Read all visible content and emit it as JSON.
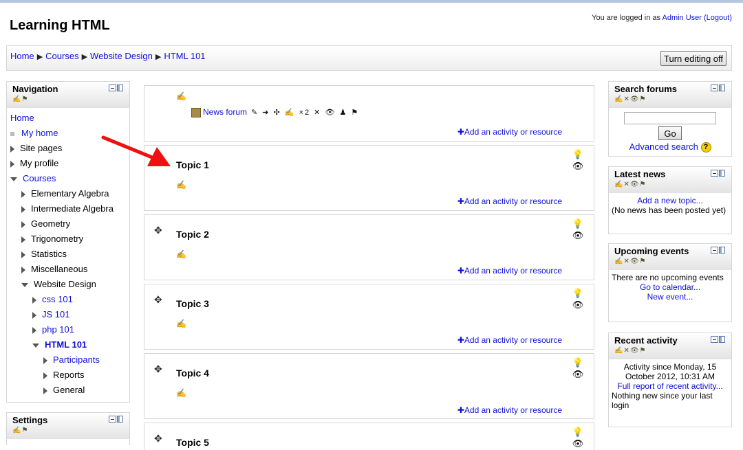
{
  "site": {
    "title": "Learning HTML"
  },
  "login": {
    "prefix": "You are logged in as",
    "user": "Admin User",
    "logout": "(Logout)"
  },
  "breadcrumb": {
    "items": [
      "Home",
      "Courses",
      "Website Design",
      "HTML 101"
    ],
    "separator": "▶"
  },
  "edit_button": "Turn editing off",
  "navigation": {
    "title": "Navigation",
    "items": [
      {
        "label": "Home",
        "level": 0,
        "marker": "none",
        "link": true
      },
      {
        "label": "My home",
        "level": 0,
        "marker": "bullet",
        "link": true
      },
      {
        "label": "Site pages",
        "level": 0,
        "marker": "collapsed",
        "link": false
      },
      {
        "label": "My profile",
        "level": 0,
        "marker": "collapsed",
        "link": false
      },
      {
        "label": "Courses",
        "level": 0,
        "marker": "expanded",
        "link": true
      },
      {
        "label": "Elementary Algebra",
        "level": 1,
        "marker": "collapsed",
        "link": false
      },
      {
        "label": "Intermediate Algebra",
        "level": 1,
        "marker": "collapsed",
        "link": false
      },
      {
        "label": "Geometry",
        "level": 1,
        "marker": "collapsed",
        "link": false
      },
      {
        "label": "Trigonometry",
        "level": 1,
        "marker": "collapsed",
        "link": false
      },
      {
        "label": "Statistics",
        "level": 1,
        "marker": "collapsed",
        "link": false
      },
      {
        "label": "Miscellaneous",
        "level": 1,
        "marker": "collapsed",
        "link": false
      },
      {
        "label": "Website Design",
        "level": 1,
        "marker": "expanded",
        "link": false
      },
      {
        "label": "css 101",
        "level": 2,
        "marker": "collapsed",
        "link": true
      },
      {
        "label": "JS 101",
        "level": 2,
        "marker": "collapsed",
        "link": true
      },
      {
        "label": "php 101",
        "level": 2,
        "marker": "collapsed",
        "link": true
      },
      {
        "label": "HTML 101",
        "level": 2,
        "marker": "expanded",
        "link": true,
        "bold": true
      },
      {
        "label": "Participants",
        "level": 3,
        "marker": "collapsed",
        "link": true
      },
      {
        "label": "Reports",
        "level": 3,
        "marker": "collapsed",
        "link": false
      },
      {
        "label": "General",
        "level": 3,
        "marker": "collapsed",
        "link": false
      }
    ]
  },
  "settings": {
    "title": "Settings"
  },
  "course": {
    "add_label": "Add an activity or resource",
    "forum_label": "News forum",
    "forum_tools": "✎ ➜ ✣ ✍ ×2 ✕ 👁 ♟ ⚑",
    "topics": [
      "Topic 1",
      "Topic 2",
      "Topic 3",
      "Topic 4",
      "Topic 5"
    ]
  },
  "search_forums": {
    "title": "Search forums",
    "go": "Go",
    "advanced": "Advanced search",
    "help": "?"
  },
  "latest_news": {
    "title": "Latest news",
    "add": "Add a new topic...",
    "empty": "(No news has been posted yet)"
  },
  "upcoming_events": {
    "title": "Upcoming events",
    "empty": "There are no upcoming events",
    "calendar": "Go to calendar...",
    "new_event": "New event..."
  },
  "recent_activity": {
    "title": "Recent activity",
    "since": "Activity since Monday, 15 October 2012, 10:31 AM",
    "full": "Full report of recent activity...",
    "none": "Nothing new since your last login"
  },
  "block_icons": "✍✕👁⚑",
  "icons": {
    "move": "move-icon",
    "edit": "edit-icon",
    "lightbulb": "lightbulb-icon",
    "eye": "eye-icon",
    "arrow": "red-arrow"
  }
}
